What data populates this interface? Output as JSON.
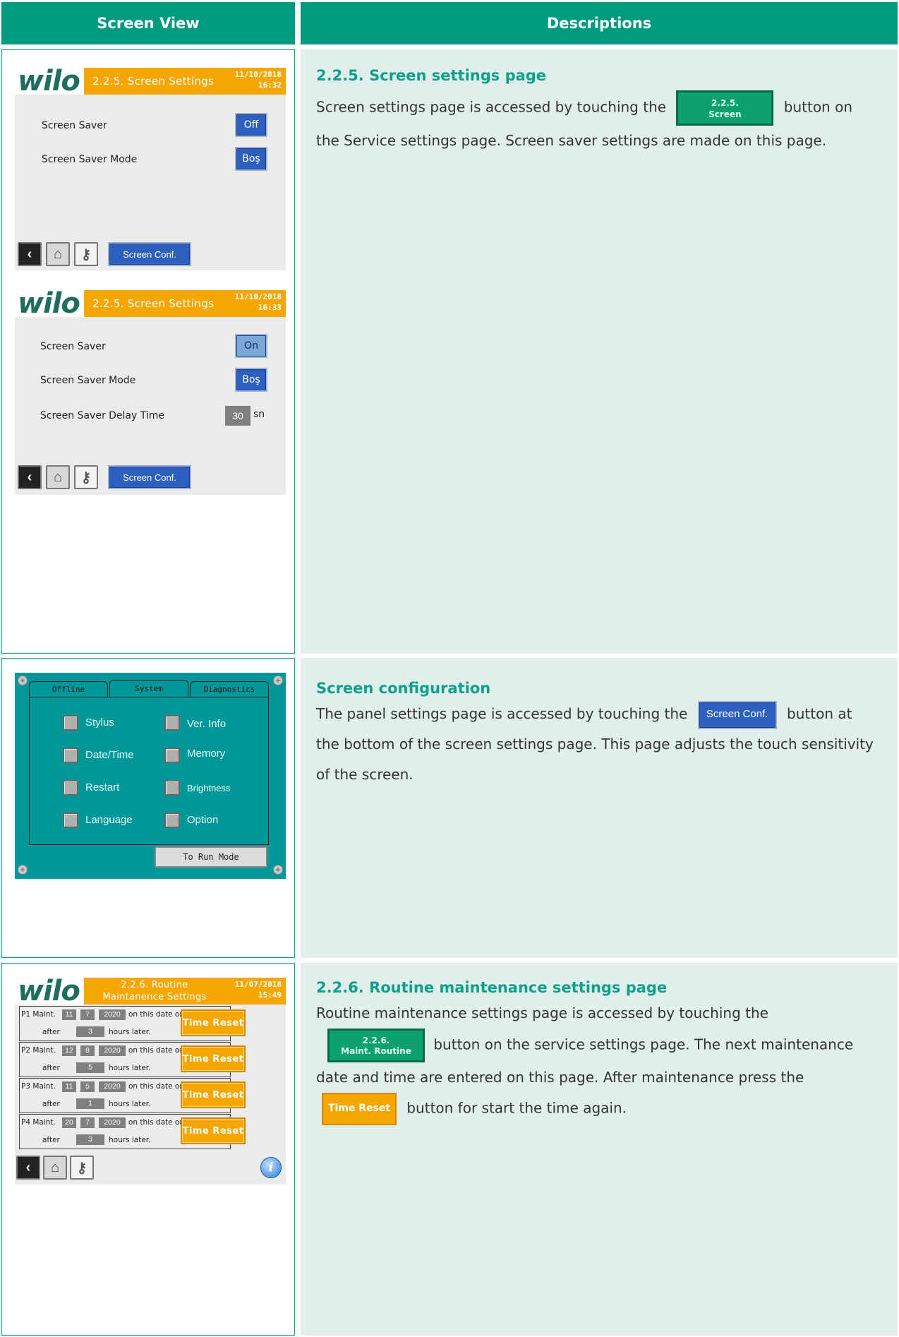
{
  "headers": {
    "left": "Screen View",
    "right": "Descriptions"
  },
  "screen_a": {
    "logo": "wilo",
    "title": "2.2.5. Screen Settings",
    "date": "11/10/2018",
    "time": "16:32",
    "rows": [
      {
        "label": "Screen Saver",
        "value": "Off"
      },
      {
        "label": "Screen Saver Mode",
        "value": "Boş"
      }
    ],
    "conf_label": "Screen Conf."
  },
  "screen_b": {
    "logo": "wilo",
    "title": "2.2.5. Screen Settings",
    "date": "11/10/2018",
    "time": "16:33",
    "rows": [
      {
        "label": "Screen Saver",
        "value": "On"
      },
      {
        "label": "Screen Saver Mode",
        "value": "Boş"
      },
      {
        "label": "Screen Saver Delay Time",
        "value": "30",
        "unit": "sn"
      }
    ],
    "conf_label": "Screen Conf."
  },
  "section1": {
    "heading": "2.2.5. Screen settings page",
    "text_before": "Screen settings page is accessed by touching the",
    "inline_button": {
      "line1": "2.2.5.",
      "line2": "Screen"
    },
    "text_after": "button on the Service settings page. Screen saver settings are made on this page."
  },
  "config_panel": {
    "tabs": [
      "Offline",
      "System",
      "Diagnostics"
    ],
    "options_left": [
      "Stylus",
      "Date/Time",
      "Restart",
      "Language"
    ],
    "options_right": [
      "Ver. Info",
      "Memory",
      "Brightness",
      "Option"
    ],
    "run_button": "To Run Mode"
  },
  "section2": {
    "heading": "Screen configuration",
    "text_before": "The panel settings page is accessed by touching the",
    "inline_button": "Screen Conf.",
    "text_after": "button at the bottom of the screen settings page. This page adjusts the touch sensitivity of the screen."
  },
  "screen_c": {
    "logo": "wilo",
    "title_line1": "2.2.6. Routine",
    "title_line2": "Maintanence Settings",
    "date": "11/07/2018",
    "time": "15:49",
    "rows": [
      {
        "name": "P1 Maint.",
        "day": "11",
        "month": "7",
        "year": "2020",
        "hours": "3"
      },
      {
        "name": "P2 Maint.",
        "day": "12",
        "month": "8",
        "year": "2020",
        "hours": "5"
      },
      {
        "name": "P3 Maint.",
        "day": "11",
        "month": "5",
        "year": "2020",
        "hours": "1"
      },
      {
        "name": "P4 Maint.",
        "day": "20",
        "month": "7",
        "year": "2020",
        "hours": "3"
      }
    ],
    "on_text": "on this date or",
    "after_text": "after",
    "hours_text": "hours later.",
    "reset_label": "Time Reset"
  },
  "section3": {
    "heading": "2.2.6. Routine maintenance settings page",
    "text_before": "Routine maintenance settings page is accessed by touching the",
    "inline_button": {
      "line1": "2.2.6.",
      "line2": "Maint. Routine"
    },
    "text_middle": "button on the service settings page. The next maintenance date and time are entered on this page. After maintenance press the",
    "inline_reset": "Time Reset",
    "text_after": "button for start the time again."
  },
  "colors": {
    "teal": "#009a80",
    "panel_bg": "#e0efec",
    "wilo_orange": "#f5a600",
    "button_blue": "#2d5fbe"
  }
}
